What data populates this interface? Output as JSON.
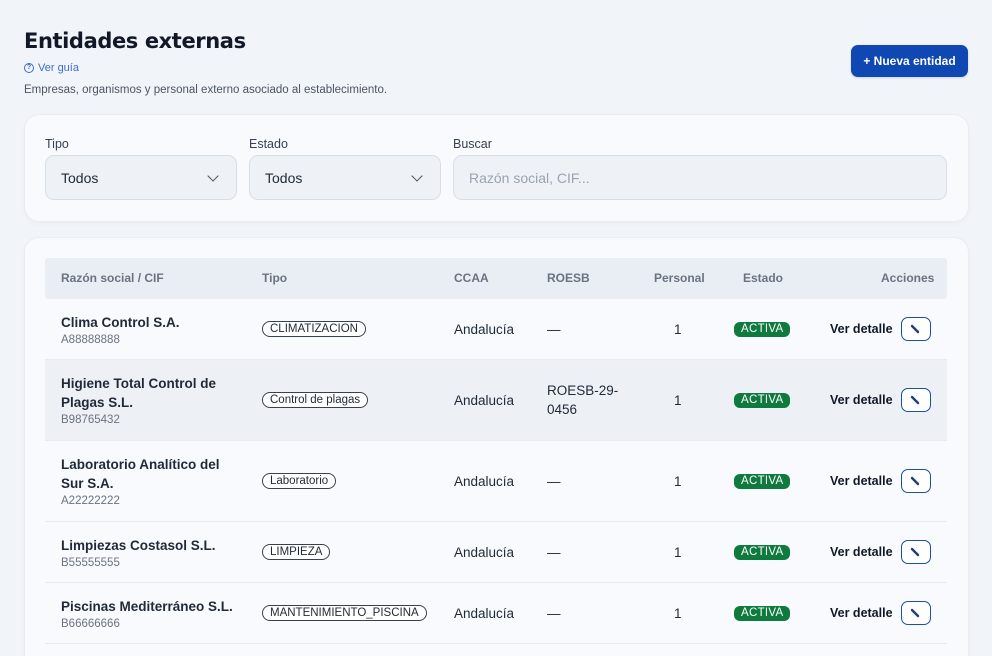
{
  "header": {
    "title": "Entidades externas",
    "guide_link": "Ver guía",
    "subtitle": "Empresas, organismos y personal externo asociado al establecimiento.",
    "new_button": "+ Nueva entidad"
  },
  "filters": {
    "tipo_label": "Tipo",
    "tipo_value": "Todos",
    "estado_label": "Estado",
    "estado_value": "Todos",
    "buscar_label": "Buscar",
    "buscar_placeholder": "Razón social, CIF..."
  },
  "table": {
    "columns": [
      "Razón social / CIF",
      "Tipo",
      "CCAA",
      "ROESB",
      "Personal",
      "Estado",
      "Acciones"
    ],
    "rows": [
      {
        "name": "Clima Control S.A.",
        "cif": "A88888888",
        "tipo": "CLIMATIZACION",
        "ccaa": "Andalucía",
        "roesb": "—",
        "personal": "1",
        "estado": "ACTIVA",
        "accion": "Ver detalle"
      },
      {
        "name": "Higiene Total Control de Plagas S.L.",
        "cif": "B98765432",
        "tipo": "Control de plagas",
        "ccaa": "Andalucía",
        "roesb": "ROESB-29-0456",
        "personal": "1",
        "estado": "ACTIVA",
        "accion": "Ver detalle"
      },
      {
        "name": "Laboratorio Analítico del Sur S.A.",
        "cif": "A22222222",
        "tipo": "Laboratorio",
        "ccaa": "Andalucía",
        "roesb": "—",
        "personal": "1",
        "estado": "ACTIVA",
        "accion": "Ver detalle"
      },
      {
        "name": "Limpiezas Costasol S.L.",
        "cif": "B55555555",
        "tipo": "LIMPIEZA",
        "ccaa": "Andalucía",
        "roesb": "—",
        "personal": "1",
        "estado": "ACTIVA",
        "accion": "Ver detalle"
      },
      {
        "name": "Piscinas Mediterráneo S.L.",
        "cif": "B66666666",
        "tipo": "MANTENIMIENTO_PISCINA",
        "ccaa": "Andalucía",
        "roesb": "—",
        "personal": "1",
        "estado": "ACTIVA",
        "accion": "Ver detalle"
      }
    ]
  },
  "colors": {
    "primary": "#0f47b3",
    "active_badge": "#0f7a3e",
    "link": "#3b6fcf"
  },
  "icons": {
    "guide": "help-circle-icon",
    "select": "chevron-down-icon",
    "edit": "pencil-icon"
  }
}
